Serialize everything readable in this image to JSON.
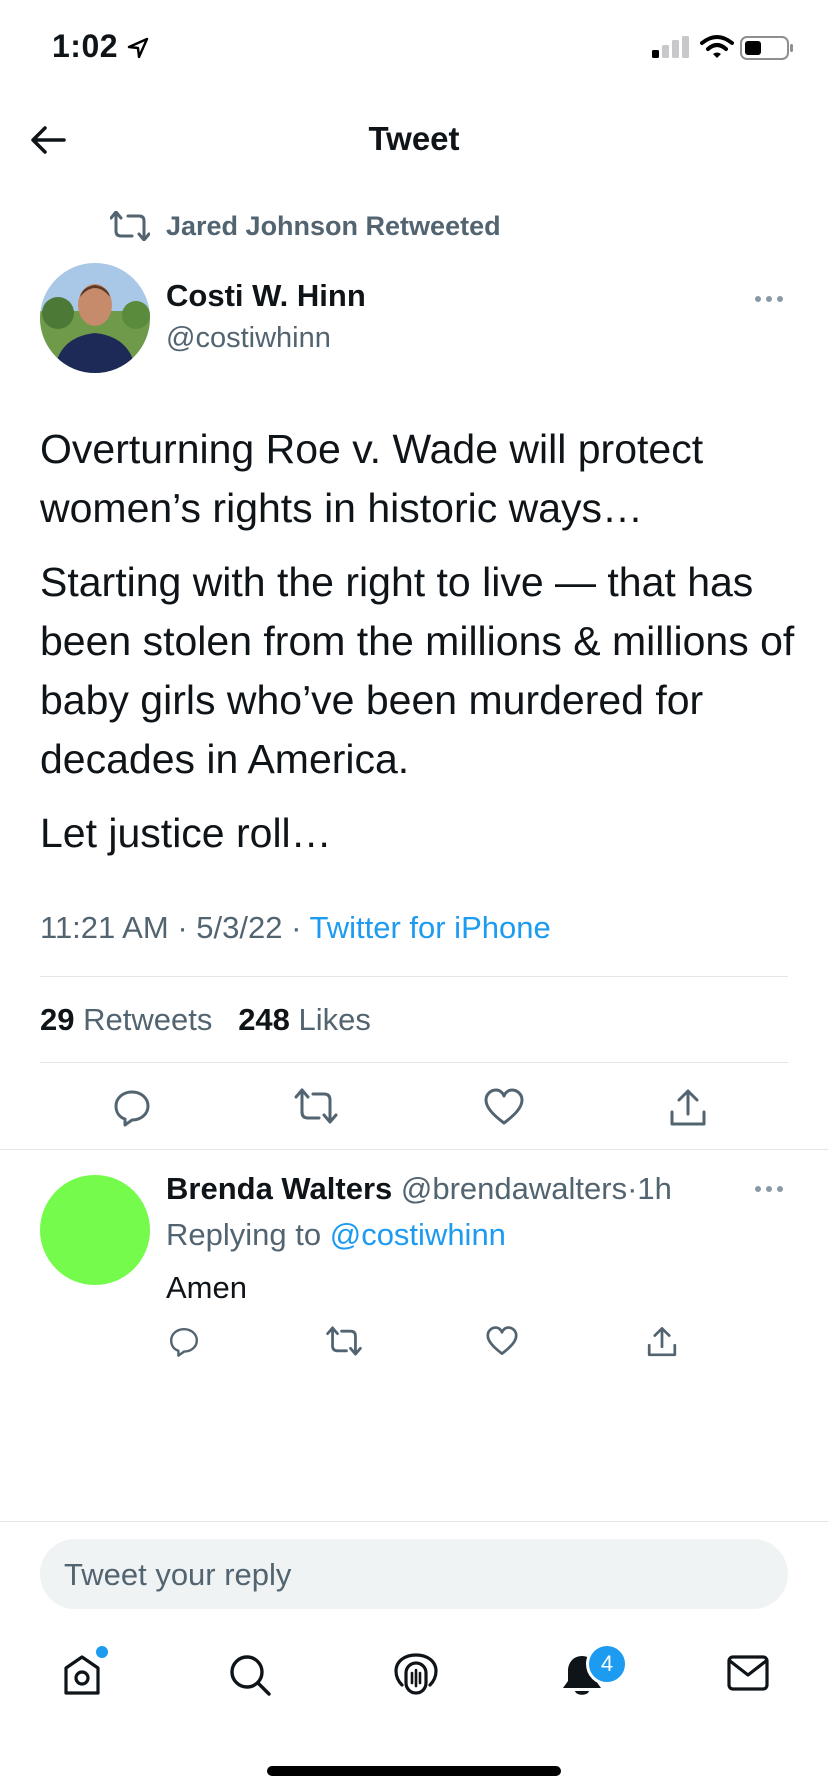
{
  "status_bar": {
    "time": "1:02"
  },
  "header": {
    "title": "Tweet"
  },
  "retweet_context": {
    "label": "Jared Johnson Retweeted"
  },
  "tweet": {
    "author_name": "Costi W. Hinn",
    "author_handle": "@costiwhinn",
    "paragraphs": [
      "Overturning Roe v. Wade will protect women’s rights in historic ways…",
      "Starting with the right to live — that has been stolen from the millions & millions of baby girls who’ve been murdered for decades in America.",
      "Let justice roll…"
    ],
    "time": "11:21 AM",
    "dot": "·",
    "date": "5/3/22",
    "source": "Twitter for iPhone",
    "retweets_count": "29",
    "retweets_label": "Retweets",
    "likes_count": "248",
    "likes_label": "Likes"
  },
  "reply": {
    "author_name": "Brenda Walters",
    "author_handle": "@brendawalters",
    "dot": "·",
    "time": "1h",
    "replying_prefix": "Replying to",
    "replying_to": "@costiwhinn",
    "text": "Amen",
    "avatar_color": "#75fb4c"
  },
  "composer": {
    "placeholder": "Tweet your reply"
  },
  "tab_bar": {
    "notifications_badge": "4"
  },
  "colors": {
    "accent": "#1d9bf0",
    "secondary_text": "#536471",
    "primary_text": "#0f1419"
  }
}
